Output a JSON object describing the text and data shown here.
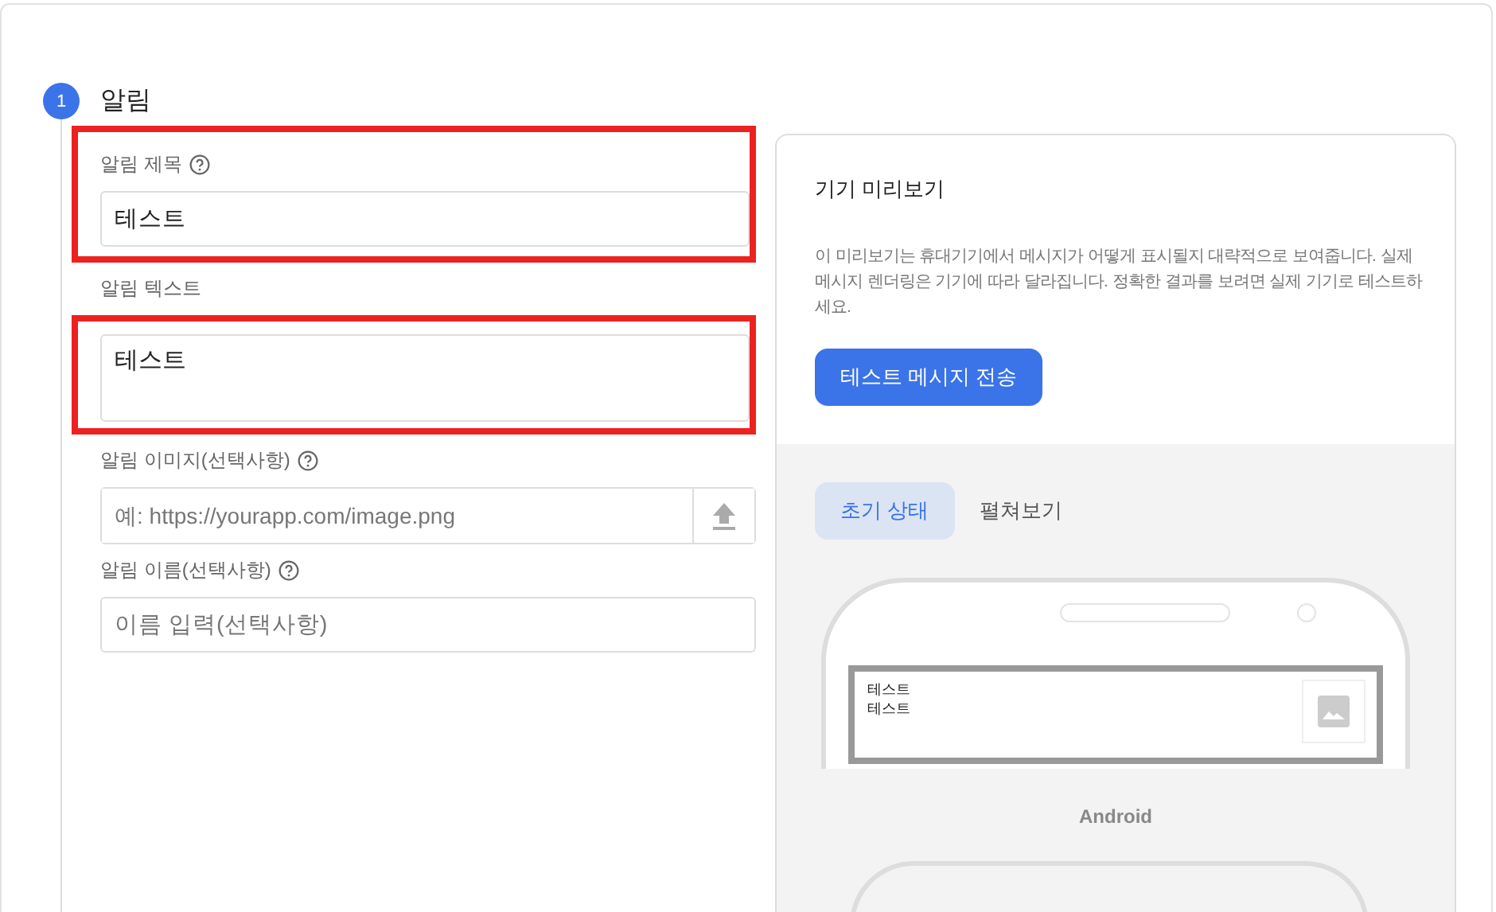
{
  "step": {
    "number": "1",
    "title": "알림"
  },
  "fields": [
    {
      "kind": "text",
      "label": "알림 제목",
      "help": true,
      "value": "테스트",
      "highlighted": true,
      "frame_includes_label": true
    },
    {
      "kind": "textarea",
      "label": "알림 텍스트",
      "help": false,
      "value": "테스트",
      "highlighted": true,
      "frame_includes_label": false
    },
    {
      "kind": "upload",
      "label": "알림 이미지(선택사항)",
      "help": true,
      "placeholder": "예: https://yourapp.com/image.png",
      "highlighted": false
    },
    {
      "kind": "text",
      "label": "알림 이름(선택사항)",
      "help": true,
      "placeholder": "이름 입력(선택사항)",
      "highlighted": false
    }
  ],
  "preview": {
    "title": "기기 미리보기",
    "description": "이 미리보기는 휴대기기에서 메시지가 어떻게 표시될지 대략적으로 보여줍니다. 실제 메시지 렌더링은 기기에 따라 달라집니다. 정확한 결과를 보려면 실제 기기로 테스트하세요.",
    "button": "테스트 메시지 전송",
    "tabs": [
      {
        "label": "초기 상태",
        "selected": true
      },
      {
        "label": "펼쳐보기",
        "selected": false
      }
    ],
    "notification": {
      "title": "테스트",
      "body": "테스트"
    },
    "device_label": "Android"
  }
}
